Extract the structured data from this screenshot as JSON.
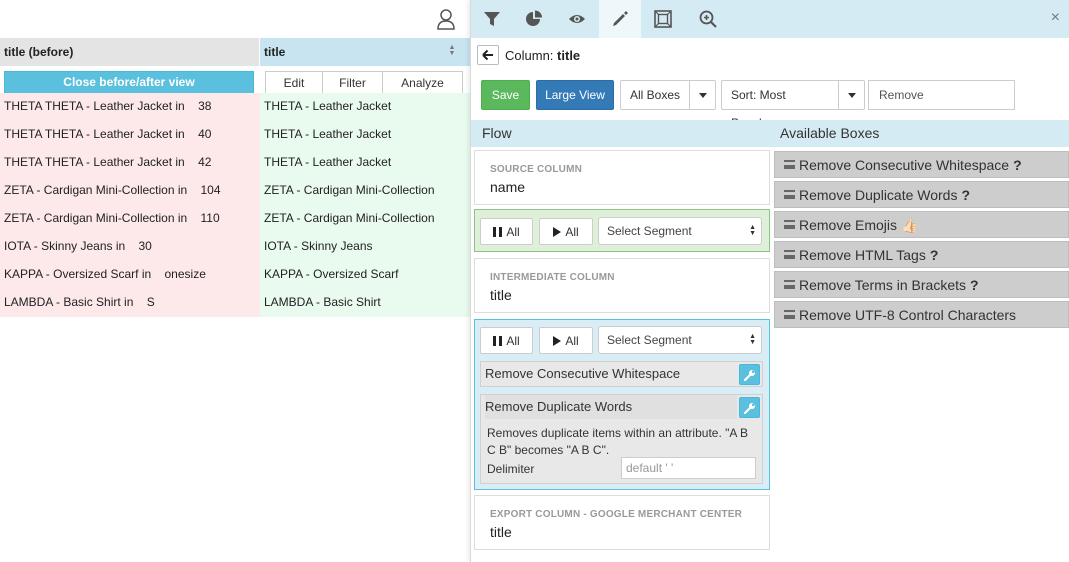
{
  "left": {
    "col_before": "title (before)",
    "col_after": "title",
    "close_view_label": "Close before/after view",
    "edit_label": "Edit",
    "filter_label": "Filter",
    "analyze_label": "Analyze",
    "rows": [
      {
        "before": "THETA THETA - Leather Jacket in    38",
        "after": "THETA - Leather Jacket"
      },
      {
        "before": "THETA THETA - Leather Jacket in    40",
        "after": "THETA - Leather Jacket"
      },
      {
        "before": "THETA THETA - Leather Jacket in    42",
        "after": "THETA - Leather Jacket"
      },
      {
        "before": "ZETA - Cardigan Mini-Collection in    104",
        "after": "ZETA - Cardigan Mini-Collection"
      },
      {
        "before": "ZETA - Cardigan Mini-Collection in    110",
        "after": "ZETA - Cardigan Mini-Collection"
      },
      {
        "before": "IOTA - Skinny Jeans in    30",
        "after": "IOTA - Skinny Jeans"
      },
      {
        "before": "KAPPA - Oversized Scarf in    onesize",
        "after": "KAPPA - Oversized Scarf"
      },
      {
        "before": "LAMBDA - Basic Shirt in    S",
        "after": "LAMBDA - Basic Shirt"
      }
    ]
  },
  "toolbar": {
    "icons": [
      "filter-icon",
      "pie-chart-icon",
      "eye-icon",
      "pencil-icon",
      "frame-icon",
      "zoom-in-icon"
    ],
    "close": "×"
  },
  "breadcrumb": {
    "prefix": "Column:",
    "column": "title"
  },
  "actions": {
    "save": "Save",
    "large_view": "Large View",
    "all_boxes": "All Boxes",
    "sort": "Sort: Most Popular",
    "search_placeholder": "Remove"
  },
  "flow": {
    "title": "Flow",
    "source": {
      "label": "SOURCE COLUMN",
      "value": "name"
    },
    "intermediate": {
      "label": "INTERMEDIATE COLUMN",
      "value": "title"
    },
    "export": {
      "label": "EXPORT COLUMN - GOOGLE MERCHANT CENTER",
      "value": "title"
    },
    "pause_all": "All",
    "play_all": "All",
    "select_segment": "Select Segment",
    "boxes": [
      {
        "title": "Remove Consecutive Whitespace"
      },
      {
        "title": "Remove Duplicate Words",
        "description": "Removes duplicate items within an attribute. \"A B C B\" becomes \"A B C\".",
        "delimiter_label": "Delimiter",
        "delimiter_placeholder": "default ' '"
      }
    ]
  },
  "available": {
    "title": "Available Boxes",
    "boxes": [
      {
        "label": "Remove Consecutive Whitespace",
        "suffix": "?"
      },
      {
        "label": "Remove Duplicate Words",
        "suffix": "?"
      },
      {
        "label": "Remove Emojis",
        "suffix": "👍🏻"
      },
      {
        "label": "Remove HTML Tags",
        "suffix": "?"
      },
      {
        "label": "Remove Terms in Brackets",
        "suffix": "?"
      },
      {
        "label": "Remove UTF-8 Control Characters",
        "suffix": ""
      }
    ]
  },
  "colors": {
    "before_bg": "#fde9ea",
    "after_bg": "#e9fbee",
    "toolbar_bg": "#d5ebf3",
    "save": "#5cb85c",
    "primary": "#337ab7",
    "info": "#5bc0de"
  }
}
